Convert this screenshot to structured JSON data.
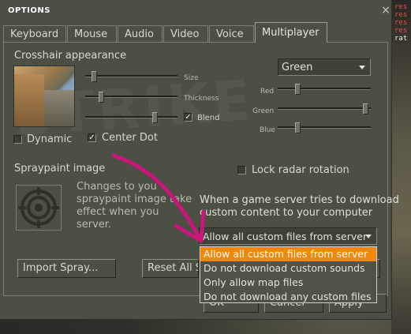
{
  "window": {
    "title": "OPTIONS",
    "close_symbol": "×"
  },
  "console": [
    "res",
    "res",
    "res",
    "res",
    "rat"
  ],
  "tabs": [
    {
      "label": "Keyboard",
      "active": false
    },
    {
      "label": "Mouse",
      "active": false
    },
    {
      "label": "Audio",
      "active": false
    },
    {
      "label": "Video",
      "active": false
    },
    {
      "label": "Voice",
      "active": false
    },
    {
      "label": "Multiplayer",
      "active": true
    }
  ],
  "crosshair": {
    "section_label": "Crosshair appearance",
    "size_label": "Size",
    "thickness_label": "Thickness",
    "blend_label": "Blend",
    "blend_checked": true,
    "dynamic_label": "Dynamic",
    "dynamic_checked": false,
    "center_dot_label": "Center Dot",
    "center_dot_checked": true,
    "color_value": "Green",
    "red_label": "Red",
    "green_label": "Green",
    "blue_label": "Blue",
    "check_glyph": "✓"
  },
  "spray": {
    "section_label": "Spraypaint image",
    "description_line1": "Changes to you",
    "description_line2": "spraypaint image take",
    "description_line3": "effect when you",
    "description_line4": "server.",
    "import_button": "Import Spray...",
    "reset_button": "Reset All St"
  },
  "radar": {
    "label": "Lock radar rotation",
    "checked": false
  },
  "download": {
    "prompt_line1": "When a game server tries to download",
    "prompt_line2": "custom content to your computer",
    "selected": "Allow all custom files from server",
    "options": [
      "Allow all custom files from server",
      "Do not download custom sounds",
      "Only allow map files",
      "Do not download any custom files"
    ]
  },
  "bottom_buttons": {
    "ok": "OK",
    "cancel": "Cancel",
    "apply": "Apply"
  },
  "colors": {
    "accent": "#f0880a",
    "annotation": "#c8167a",
    "dialog_bg": "#4b4f44"
  }
}
